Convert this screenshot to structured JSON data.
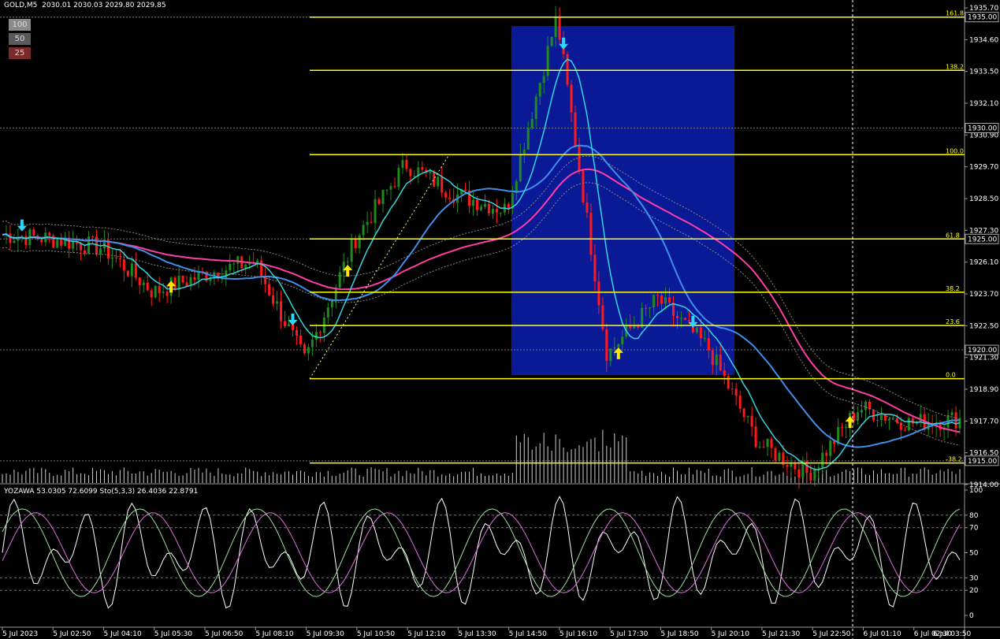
{
  "header": {
    "symbol": "GOLD,M5",
    "ohlc": "2030.01 2030.03 2029.80 2029.85",
    "indicator_label": "YOZAWA 53.0305 72.6099  Sto(5,3,3) 26.4036 22.8791"
  },
  "zoom_buttons": [
    {
      "label": "100",
      "color": "#8a8a8a"
    },
    {
      "label": "50",
      "color": "#5a5a5a"
    },
    {
      "label": "25",
      "color": "#7a2a2a"
    }
  ],
  "price_axis": {
    "ticks": [
      "1935.70",
      "1934.60",
      "1933.50",
      "1932.10",
      "1930.90",
      "1929.70",
      "1928.50",
      "1927.30",
      "1926.10",
      "1923.70",
      "1922.50",
      "1921.30",
      "1918.90",
      "1917.70",
      "1916.50",
      "1914.00"
    ],
    "boxed": [
      {
        "label": "1935.00",
        "price": 1935.0
      },
      {
        "label": "1930.00",
        "price": 1930.0
      },
      {
        "label": "1925.00",
        "price": 1925.0
      },
      {
        "label": "1920.00",
        "price": 1920.0
      },
      {
        "label": "1915.00",
        "price": 1915.0
      }
    ],
    "min": 1914.0,
    "max": 1935.7
  },
  "time_axis": [
    "5 Jul 2023",
    "5 Jul 02:50",
    "5 Jul 04:10",
    "5 Jul 05:30",
    "5 Jul 06:50",
    "5 Jul 08:10",
    "5 Jul 09:30",
    "5 Jul 10:50",
    "5 Jul 12:10",
    "5 Jul 13:30",
    "5 Jul 14:50",
    "5 Jul 16:10",
    "5 Jul 17:30",
    "5 Jul 18:50",
    "5 Jul 20:10",
    "5 Jul 21:30",
    "5 Jul 22:50",
    "6 Jul 01:10",
    "6 Jul 02:30",
    "6 Jul 03:50"
  ],
  "fibonacci": {
    "color": "#ffff00",
    "levels": [
      {
        "label": "161.8",
        "price": 1935.0
      },
      {
        "label": "138.2",
        "price": 1932.6
      },
      {
        "label": "100.0",
        "price": 1928.8
      },
      {
        "label": "61.8",
        "price": 1925.0
      },
      {
        "label": "38.2",
        "price": 1922.6
      },
      {
        "label": "23.6",
        "price": 1921.1
      },
      {
        "label": "0.0",
        "price": 1918.7
      },
      {
        "label": "-38.2",
        "price": 1914.9
      }
    ]
  },
  "oscillator_axis": {
    "ticks": [
      "100",
      "80",
      "70",
      "50",
      "30",
      "20",
      "0"
    ],
    "dashed_levels": [
      80,
      70,
      30,
      20
    ]
  },
  "colors": {
    "bull": "#1f8a1f",
    "bear": "#ff1a1a",
    "highlight_box": "#0a1a96",
    "ma_fast": "#33d6e0",
    "ma_mid": "#3f8fe8",
    "ma_slow": "#ff3ea5",
    "up_arrow": "#ffe800",
    "down_arrow": "#2fd7ff",
    "stoch_main": "#9fe09f",
    "stoch_signal": "#e070e0",
    "yozawa": "#ffffff"
  },
  "chart_data": {
    "type": "candlestick",
    "symbol": "GOLD",
    "timeframe": "M5",
    "x_labels": [
      "5 Jul 2023",
      "5 Jul 02:50",
      "5 Jul 04:10",
      "5 Jul 05:30",
      "5 Jul 06:50",
      "5 Jul 08:10",
      "5 Jul 09:30",
      "5 Jul 10:50",
      "5 Jul 12:10",
      "5 Jul 13:30",
      "5 Jul 14:50",
      "5 Jul 16:10",
      "5 Jul 17:30",
      "5 Jul 18:50",
      "5 Jul 20:10",
      "5 Jul 21:30",
      "5 Jul 22:50",
      "6 Jul 01:10",
      "6 Jul 02:30",
      "6 Jul 03:50"
    ],
    "close_at_labels": [
      1925.2,
      1925.0,
      1924.6,
      1922.6,
      1923.4,
      1924.0,
      1919.5,
      1925.0,
      1928.4,
      1927.0,
      1926.3,
      1935.0,
      1919.8,
      1922.3,
      1920.1,
      1915.8,
      1914.4,
      1917.4,
      1916.7,
      1916.9
    ],
    "ylim": [
      1914.0,
      1935.7
    ],
    "oscillator": {
      "name": "YOZAWA / Sto(5,3,3)",
      "ylim": [
        0,
        100
      ]
    }
  }
}
